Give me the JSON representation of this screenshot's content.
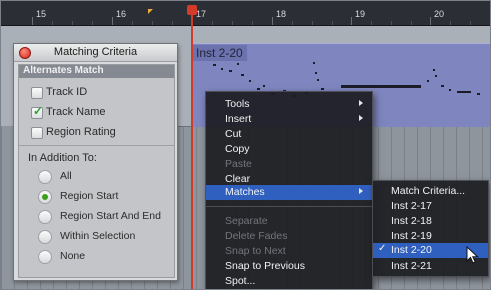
{
  "ruler": {
    "bars": [
      "15",
      "16",
      "17",
      "18",
      "19",
      "20"
    ]
  },
  "region": {
    "title": "Inst 2-20"
  },
  "matching_criteria": {
    "title": "Matching Criteria",
    "section_label": "Alternates Match",
    "checkboxes": [
      {
        "label": "Track ID",
        "checked": false
      },
      {
        "label": "Track Name",
        "checked": true
      },
      {
        "label": "Region Rating",
        "checked": false
      }
    ],
    "addition_label": "In Addition To:",
    "radios": [
      {
        "label": "All",
        "selected": false
      },
      {
        "label": "Region Start",
        "selected": true
      },
      {
        "label": "Region Start And End",
        "selected": false
      },
      {
        "label": "Within Selection",
        "selected": false
      },
      {
        "label": "None",
        "selected": false
      }
    ]
  },
  "context_menu": {
    "items": [
      {
        "label": "Tools",
        "submenu": true,
        "enabled": true
      },
      {
        "label": "Insert",
        "submenu": true,
        "enabled": true
      },
      {
        "label": "Cut",
        "enabled": true
      },
      {
        "label": "Copy",
        "enabled": true
      },
      {
        "label": "Paste",
        "enabled": false
      },
      {
        "label": "Clear",
        "enabled": true
      },
      {
        "label": "Matches",
        "submenu": true,
        "enabled": true,
        "highlighted": true
      },
      {
        "label": "Separate",
        "enabled": false
      },
      {
        "label": "Delete Fades",
        "enabled": false
      },
      {
        "label": "Snap to Next",
        "enabled": false
      },
      {
        "label": "Snap to Previous",
        "enabled": true
      },
      {
        "label": "Spot...",
        "enabled": true
      }
    ]
  },
  "matches_submenu": {
    "items": [
      {
        "label": "Match Criteria...",
        "checked": false
      },
      {
        "label": "Inst 2-17",
        "checked": false
      },
      {
        "label": "Inst 2-18",
        "checked": false
      },
      {
        "label": "Inst 2-19",
        "checked": false
      },
      {
        "label": "Inst 2-20",
        "checked": true,
        "highlighted": true
      },
      {
        "label": "Inst 2-21",
        "checked": false
      }
    ],
    "check_glyph": "✓"
  },
  "colors": {
    "highlight": "#3060bf",
    "playhead": "#d33a2a",
    "region": "#7f86bf",
    "check_green": "#27a12a"
  }
}
